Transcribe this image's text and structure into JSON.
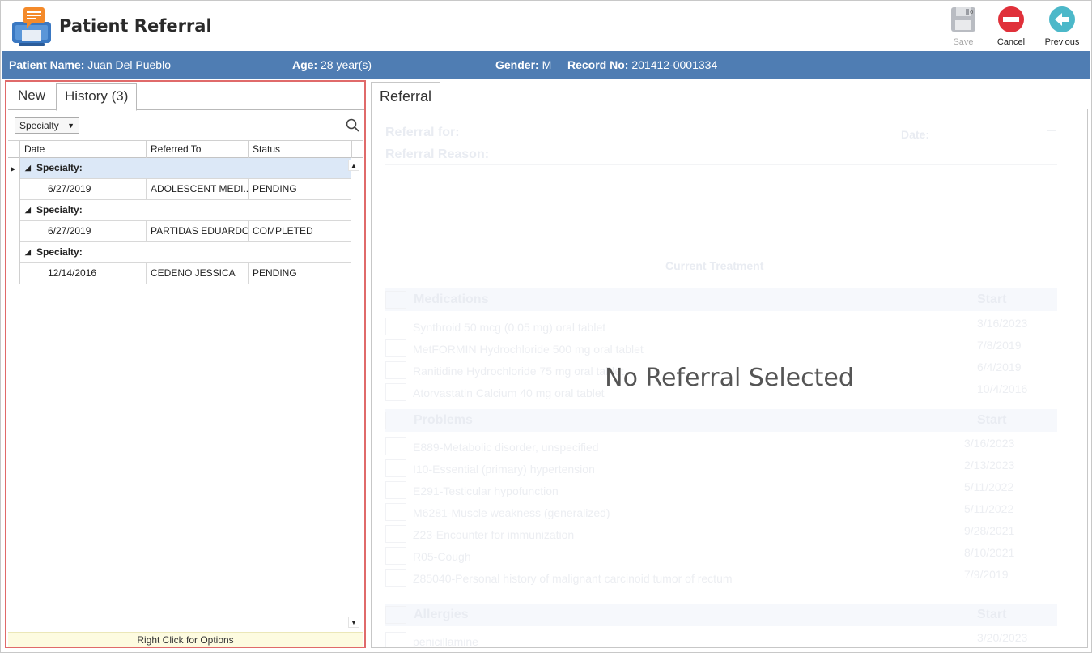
{
  "window": {
    "title": "Patient Referral"
  },
  "toolbar": {
    "save_label": "Save",
    "cancel_label": "Cancel",
    "previous_label": "Previous",
    "save_badge": "0"
  },
  "patient": {
    "name_label": "Patient Name:",
    "name": "Juan Del Pueblo",
    "age_label": "Age:",
    "age": "28 year(s)",
    "gender_label": "Gender:",
    "gender": "M",
    "record_label": "Record No:",
    "record_no": "201412-0001334"
  },
  "left_tabs": [
    {
      "label": "New"
    },
    {
      "label": "History",
      "count": "(3)"
    }
  ],
  "filter": {
    "group_by": "Specialty"
  },
  "grid": {
    "columns": [
      "Date",
      "Referred To",
      "Status"
    ],
    "groups": [
      {
        "label": "Specialty:",
        "rows": [
          {
            "date": "6/27/2019",
            "referred_to": "ADOLESCENT MEDI...",
            "status": "PENDING"
          }
        ]
      },
      {
        "label": "Specialty:",
        "rows": [
          {
            "date": "6/27/2019",
            "referred_to": "PARTIDAS EDUARDO",
            "status": "COMPLETED"
          }
        ]
      },
      {
        "label": "Specialty:",
        "rows": [
          {
            "date": "12/14/2016",
            "referred_to": "CEDENO JESSICA",
            "status": "PENDING"
          }
        ]
      }
    ]
  },
  "status_strip": "Right Click for Options",
  "right_tab": {
    "label": "Referral"
  },
  "referral_form": {
    "referral_for_label": "Referral for:",
    "referral_reason_label": "Referral Reason:",
    "date_label": "Date:",
    "current_treatment_label": "Current Treatment",
    "start_label": "Start",
    "medications_label": "Medications",
    "medications": [
      {
        "name": "Synthroid 50 mcg (0.05 mg) oral tablet",
        "start": "3/16/2023"
      },
      {
        "name": "MetFORMIN Hydrochloride 500 mg oral tablet",
        "start": "7/8/2019"
      },
      {
        "name": "Ranitidine Hydrochloride 75 mg oral tablet",
        "start": "6/4/2019"
      },
      {
        "name": "Atorvastatin Calcium 40 mg oral tablet",
        "start": "10/4/2016"
      }
    ],
    "problems_label": "Problems",
    "problems": [
      {
        "name": "E889-Metabolic disorder, unspecified",
        "start": "3/16/2023"
      },
      {
        "name": "I10-Essential (primary) hypertension",
        "start": "2/13/2023"
      },
      {
        "name": "E291-Testicular hypofunction",
        "start": "5/11/2022"
      },
      {
        "name": "M6281-Muscle weakness (generalized)",
        "start": "5/11/2022"
      },
      {
        "name": "Z23-Encounter for immunization",
        "start": "9/28/2021"
      },
      {
        "name": "R05-Cough",
        "start": "8/10/2021"
      },
      {
        "name": "Z85040-Personal history of malignant carcinoid tumor of rectum",
        "start": "7/9/2019"
      }
    ],
    "allergies_label": "Allergies",
    "allergies": [
      {
        "name": "penicillamine",
        "start": "3/20/2023"
      }
    ]
  },
  "overlay_message": "No Referral Selected",
  "colors": {
    "banner": "#4f7db3",
    "highlight_border": "#e06a6a",
    "selected_row": "#dce8f7",
    "status_strip": "#fdfbe0",
    "cancel": "#e0303a",
    "previous": "#4cb8c9"
  }
}
